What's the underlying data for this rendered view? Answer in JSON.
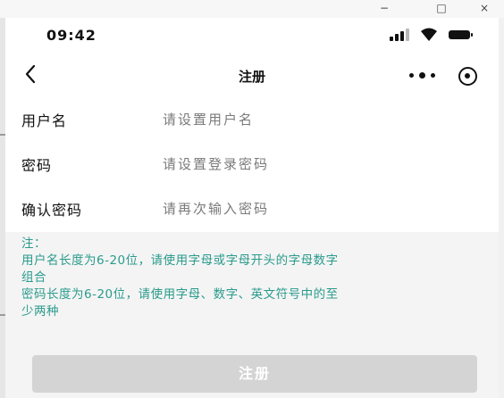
{
  "window": {
    "minimize": "−",
    "maximize": "□",
    "close": "×"
  },
  "status": {
    "time": "09:42",
    "icons": [
      "signal-icon",
      "wifi-icon",
      "battery-icon"
    ]
  },
  "nav": {
    "title": "注册",
    "icons": [
      "back-icon",
      "more-icon",
      "target-icon"
    ]
  },
  "form": {
    "username": {
      "label": "用户名",
      "placeholder": "请设置用户名",
      "value": ""
    },
    "password": {
      "label": "密码",
      "placeholder": "请设置登录密码",
      "value": ""
    },
    "confirm": {
      "label": "确认密码",
      "placeholder": "请再次输入密码",
      "value": ""
    }
  },
  "notes": {
    "title": "注：",
    "line1": "用户名长度为6-20位，请使用字母或字母开头的字母数字",
    "line2": "组合",
    "line3": "密码长度为6-20位，请使用字母、数字、英文符号中的至",
    "line4": "少两种"
  },
  "submit": {
    "label": "注册",
    "enabled": false
  },
  "colors": {
    "note": "#2a9b8c",
    "button_disabled": "#d4d4d4",
    "background": "#f4f4f4"
  }
}
